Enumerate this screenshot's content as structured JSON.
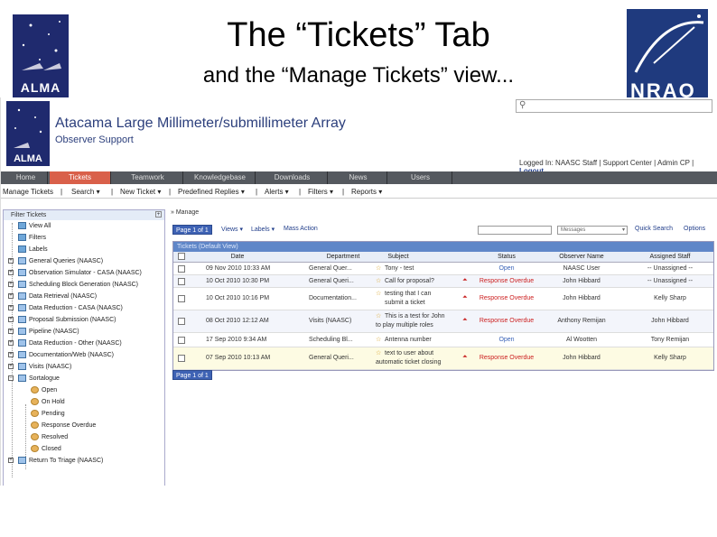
{
  "slide": {
    "title": "The “Tickets” Tab",
    "subtitle": "and the “Manage Tickets” view...",
    "logo_left": "ALMA",
    "logo_right": "NRAO"
  },
  "site": {
    "logo": "ALMA",
    "name": "Atacama Large Millimeter/submillimeter Array",
    "sub": "Observer Support",
    "logged_in": "Logged In: NAASC Staff | Support Center | Admin CP |",
    "logout": "Logout"
  },
  "nav": [
    "Home",
    "Tickets",
    "Teamwork",
    "Knowledgebase",
    "Downloads",
    "News",
    "Users"
  ],
  "subnav": [
    "Manage Tickets",
    "Search ▾",
    "New Ticket ▾",
    "Predefined Replies ▾",
    "Alerts ▾",
    "Filters ▾",
    "Reports ▾"
  ],
  "sidebar": {
    "header": "Filter Tickets",
    "items": [
      "View All",
      "Filters",
      "Labels",
      "General Queries (NAASC)",
      "Observation Simulator - CASA (NAASC)",
      "Scheduling Block Generation (NAASC)",
      "Data Retrieval (NAASC)",
      "Data Reduction - CASA (NAASC)",
      "Proposal Submission (NAASC)",
      "Pipeline (NAASC)",
      "Data Reduction - Other (NAASC)",
      "Documentation/Web (NAASC)",
      "Visits (NAASC)",
      "Sortalogue",
      "Open",
      "On Hold",
      "Pending",
      "Response Overdue",
      "Resolved",
      "Closed",
      "Return To Triage (NAASC)"
    ]
  },
  "main": {
    "breadcrumb": "» Manage",
    "page": "Page 1 of 1",
    "views": "Views ▾",
    "labels": "Labels ▾",
    "mass_action": "Mass Action",
    "select_value": "Messages",
    "quick_search": "Quick Search",
    "options": "Options",
    "grid_caption": "Tickets (Default View)",
    "columns": [
      "Date",
      "Department",
      "Subject",
      "Status",
      "Observer Name",
      "Assigned Staff"
    ],
    "rows": [
      {
        "date": "09 Nov 2010 10:33 AM",
        "dept": "General Quer...",
        "subject": "Tony - test",
        "subject2": "",
        "status": "Open",
        "observer": "NAASC User",
        "staff": "-- Unassigned --"
      },
      {
        "date": "10 Oct 2010 10:30 PM",
        "dept": "General Queri...",
        "subject": "Call for proposal?",
        "subject2": "",
        "status": "Response Overdue",
        "observer": "John Hibbard",
        "staff": "-- Unassigned --"
      },
      {
        "date": "10 Oct 2010 10:16 PM",
        "dept": "Documentation...",
        "subject": "testing that I can",
        "subject2": "submit a ticket",
        "status": "Response Overdue",
        "observer": "John Hibbard",
        "staff": "Kelly Sharp"
      },
      {
        "date": "08 Oct 2010 12:12 AM",
        "dept": "Visits (NAASC)",
        "subject": "This is a test for John",
        "subject2": "to play multiple roles",
        "status": "Response Overdue",
        "observer": "Anthony Remijan",
        "staff": "John Hibbard"
      },
      {
        "date": "17 Sep 2010 9:34 AM",
        "dept": "Scheduling Bl...",
        "subject": "Antenna number",
        "subject2": "",
        "status": "Open",
        "observer": "Al Wootten",
        "staff": "Tony Remijan"
      },
      {
        "date": "07 Sep 2010 10:13 AM",
        "dept": "General Queri...",
        "subject": "text to user about",
        "subject2": "automatic ticket closing",
        "status": "Response Overdue",
        "observer": "John Hibbard",
        "staff": "Kelly Sharp"
      }
    ]
  },
  "colors": {
    "nav_bg": "#55595f",
    "active_tab": "#d9604a",
    "grid_caption": "#5f86c8",
    "overdue": "#cc2020",
    "open": "#3a63b8"
  }
}
